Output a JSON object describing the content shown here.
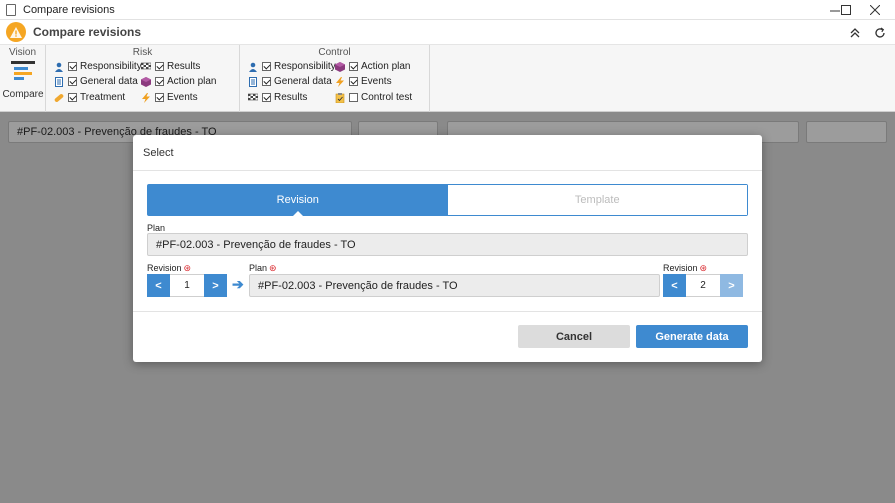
{
  "window": {
    "title": "Compare revisions"
  },
  "header": {
    "title": "Compare revisions"
  },
  "ribbon": {
    "vision": {
      "title": "Vision",
      "compare_label": "Compare"
    },
    "risk": {
      "title": "Risk",
      "items": [
        {
          "label": "Responsibility",
          "checked": true
        },
        {
          "label": "General data",
          "checked": true
        },
        {
          "label": "Treatment",
          "checked": true
        },
        {
          "label": "Results",
          "checked": true
        },
        {
          "label": "Action plan",
          "checked": true
        },
        {
          "label": "Events",
          "checked": true
        }
      ]
    },
    "control": {
      "title": "Control",
      "items": [
        {
          "label": "Responsibility",
          "checked": true
        },
        {
          "label": "General data",
          "checked": true
        },
        {
          "label": "Results",
          "checked": true
        },
        {
          "label": "Action plan",
          "checked": true
        },
        {
          "label": "Events",
          "checked": true
        },
        {
          "label": "Control test",
          "checked": false
        }
      ]
    }
  },
  "background": {
    "plan_field": "#PF-02.003 - Prevenção de fraudes - TO"
  },
  "modal": {
    "title": "Select",
    "tabs": [
      {
        "label": "Revision",
        "active": true
      },
      {
        "label": "Template",
        "active": false
      }
    ],
    "plan_label": "Plan",
    "plan_value": "#PF-02.003 - Prevenção de fraudes - TO",
    "left_revision": {
      "label": "Revision",
      "prev": "<",
      "value": "1",
      "next": ">"
    },
    "plan2_label": "Plan",
    "plan2_value": "#PF-02.003 - Prevenção de fraudes - TO",
    "right_revision": {
      "label": "Revision",
      "prev": "<",
      "value": "2",
      "next": ">"
    },
    "cancel_label": "Cancel",
    "generate_label": "Generate data"
  },
  "colors": {
    "accent": "#3e8ad0",
    "required": "#d9262c",
    "logo": "#f5a623"
  }
}
